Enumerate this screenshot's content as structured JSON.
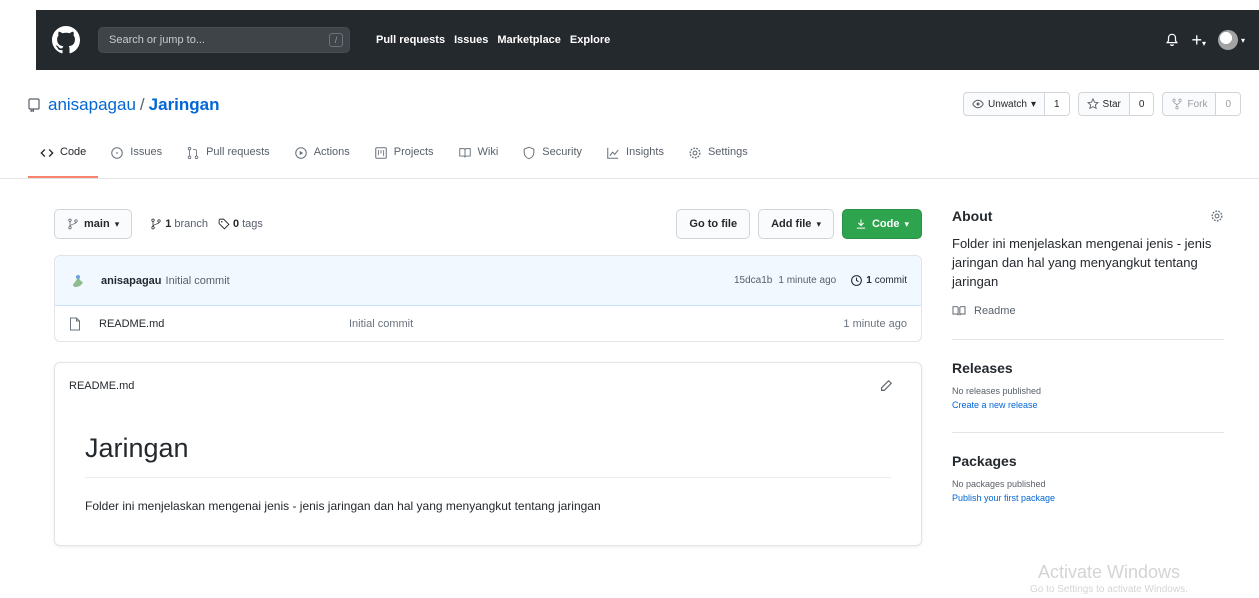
{
  "header": {
    "search_placeholder": "Search or jump to...",
    "search_shortcut": "/",
    "nav": [
      "Pull requests",
      "Issues",
      "Marketplace",
      "Explore"
    ],
    "plus": "+",
    "caret": "▾"
  },
  "repo": {
    "owner": "anisapagau",
    "slash": "/",
    "name": "Jaringan",
    "watch_label": "Unwatch",
    "watch_count": "1",
    "star_label": "Star",
    "star_count": "0",
    "fork_label": "Fork",
    "fork_count": "0",
    "caret": "▾"
  },
  "tabs": [
    {
      "label": "Code",
      "icon": "code-icon"
    },
    {
      "label": "Issues",
      "icon": "issue-icon"
    },
    {
      "label": "Pull requests",
      "icon": "pull-request-icon"
    },
    {
      "label": "Actions",
      "icon": "actions-icon"
    },
    {
      "label": "Projects",
      "icon": "project-icon"
    },
    {
      "label": "Wiki",
      "icon": "book-icon"
    },
    {
      "label": "Security",
      "icon": "shield-icon"
    },
    {
      "label": "Insights",
      "icon": "graph-icon"
    },
    {
      "label": "Settings",
      "icon": "gear-icon"
    }
  ],
  "branchbar": {
    "branch": "main",
    "caret": "▾",
    "branch_count": "1",
    "branch_word": "branch",
    "tag_count": "0",
    "tag_word": "tags",
    "go_to_file": "Go to file",
    "add_file": "Add file",
    "code": "Code"
  },
  "commit": {
    "author": "anisapagau",
    "message": "Initial commit",
    "hash": "15dca1b",
    "age": "1 minute ago",
    "count": "1",
    "count_word": "commit"
  },
  "files": [
    {
      "name": "README.md",
      "message": "Initial commit",
      "age": "1 minute ago"
    }
  ],
  "readme": {
    "filename": "README.md",
    "title": "Jaringan",
    "text": "Folder ini menjelaskan mengenai jenis - jenis jaringan dan hal yang menyangkut tentang jaringan"
  },
  "sidebar": {
    "about": "About",
    "description": "Folder ini menjelaskan mengenai jenis - jenis jaringan dan hal yang menyangkut tentang jaringan",
    "readme_label": "Readme",
    "releases_title": "Releases",
    "releases_none": "No releases published",
    "releases_link": "Create a new release",
    "packages_title": "Packages",
    "packages_none": "No packages published",
    "packages_link": "Publish your first package"
  },
  "watermark": {
    "line1": "Activate Windows",
    "line2": "Go to Settings to activate Windows."
  },
  "colors": {
    "header_bg": "#24292e",
    "link": "#0366d6",
    "green": "#2ea44f",
    "tab_underline": "#f9826c",
    "commit_bg": "#f1f8ff"
  }
}
